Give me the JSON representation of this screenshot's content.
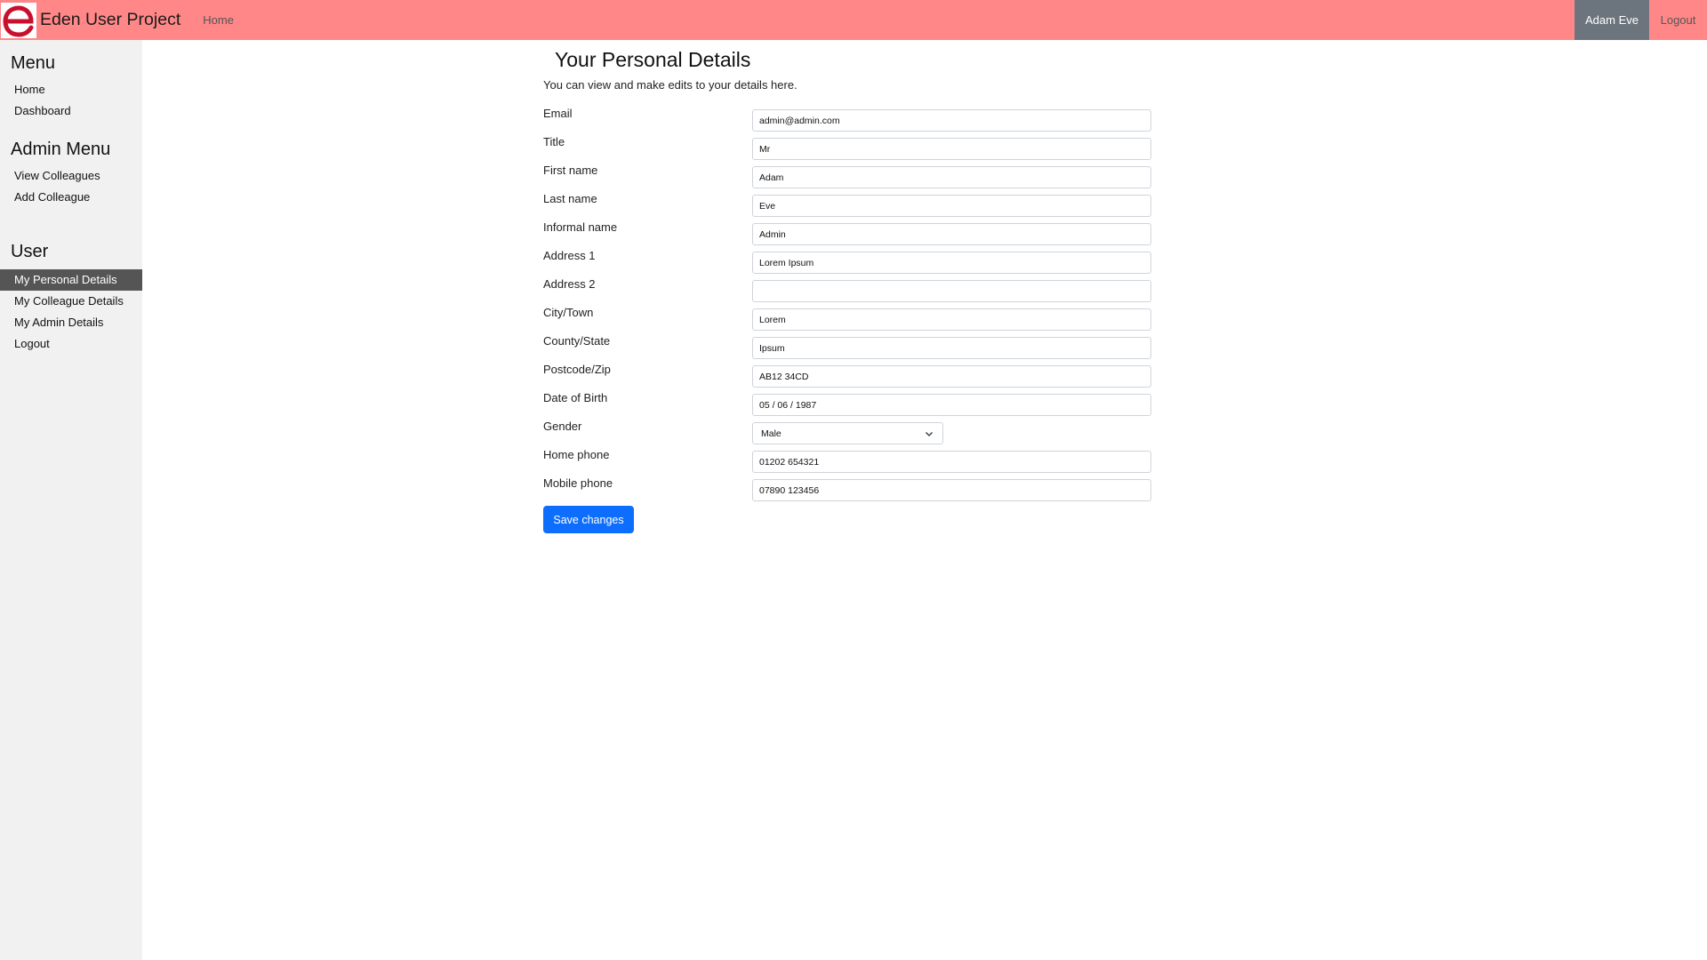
{
  "navbar": {
    "brand": "Eden User Project",
    "home": "Home",
    "user": "Adam Eve",
    "logout": "Logout",
    "logo_color": "#c8102e",
    "background": "#ff8787"
  },
  "sidebar": {
    "menu_heading": "Menu",
    "menu_items": [
      "Home",
      "Dashboard"
    ],
    "admin_heading": "Admin Menu",
    "admin_items": [
      "View Colleagues",
      "Add Colleague"
    ],
    "user_heading": "User",
    "user_items": [
      "My Personal Details",
      "My Colleague Details",
      "My Admin Details",
      "Logout"
    ],
    "active_item": "My Personal Details"
  },
  "main": {
    "title": "Your Personal Details",
    "intro": "You can view and make edits to your details here.",
    "fields": [
      {
        "label": "Email",
        "value": "admin@admin.com"
      },
      {
        "label": "Title",
        "value": "Mr"
      },
      {
        "label": "First name",
        "value": "Adam"
      },
      {
        "label": "Last name",
        "value": "Eve"
      },
      {
        "label": "Informal name",
        "value": "Admin"
      },
      {
        "label": "Address 1",
        "value": "Lorem Ipsum"
      },
      {
        "label": "Address 2",
        "value": ""
      },
      {
        "label": "City/Town",
        "value": "Lorem"
      },
      {
        "label": "County/State",
        "value": "Ipsum"
      },
      {
        "label": "Postcode/Zip",
        "value": "AB12 34CD"
      },
      {
        "label": "Date of Birth",
        "value": "05 / 06 / 1987"
      },
      {
        "label": "Gender",
        "value": "Male"
      },
      {
        "label": "Home phone",
        "value": "01202 654321"
      },
      {
        "label": "Mobile phone",
        "value": "07890 123456"
      }
    ],
    "save_label": "Save changes",
    "save_color": "#0d6efd"
  }
}
